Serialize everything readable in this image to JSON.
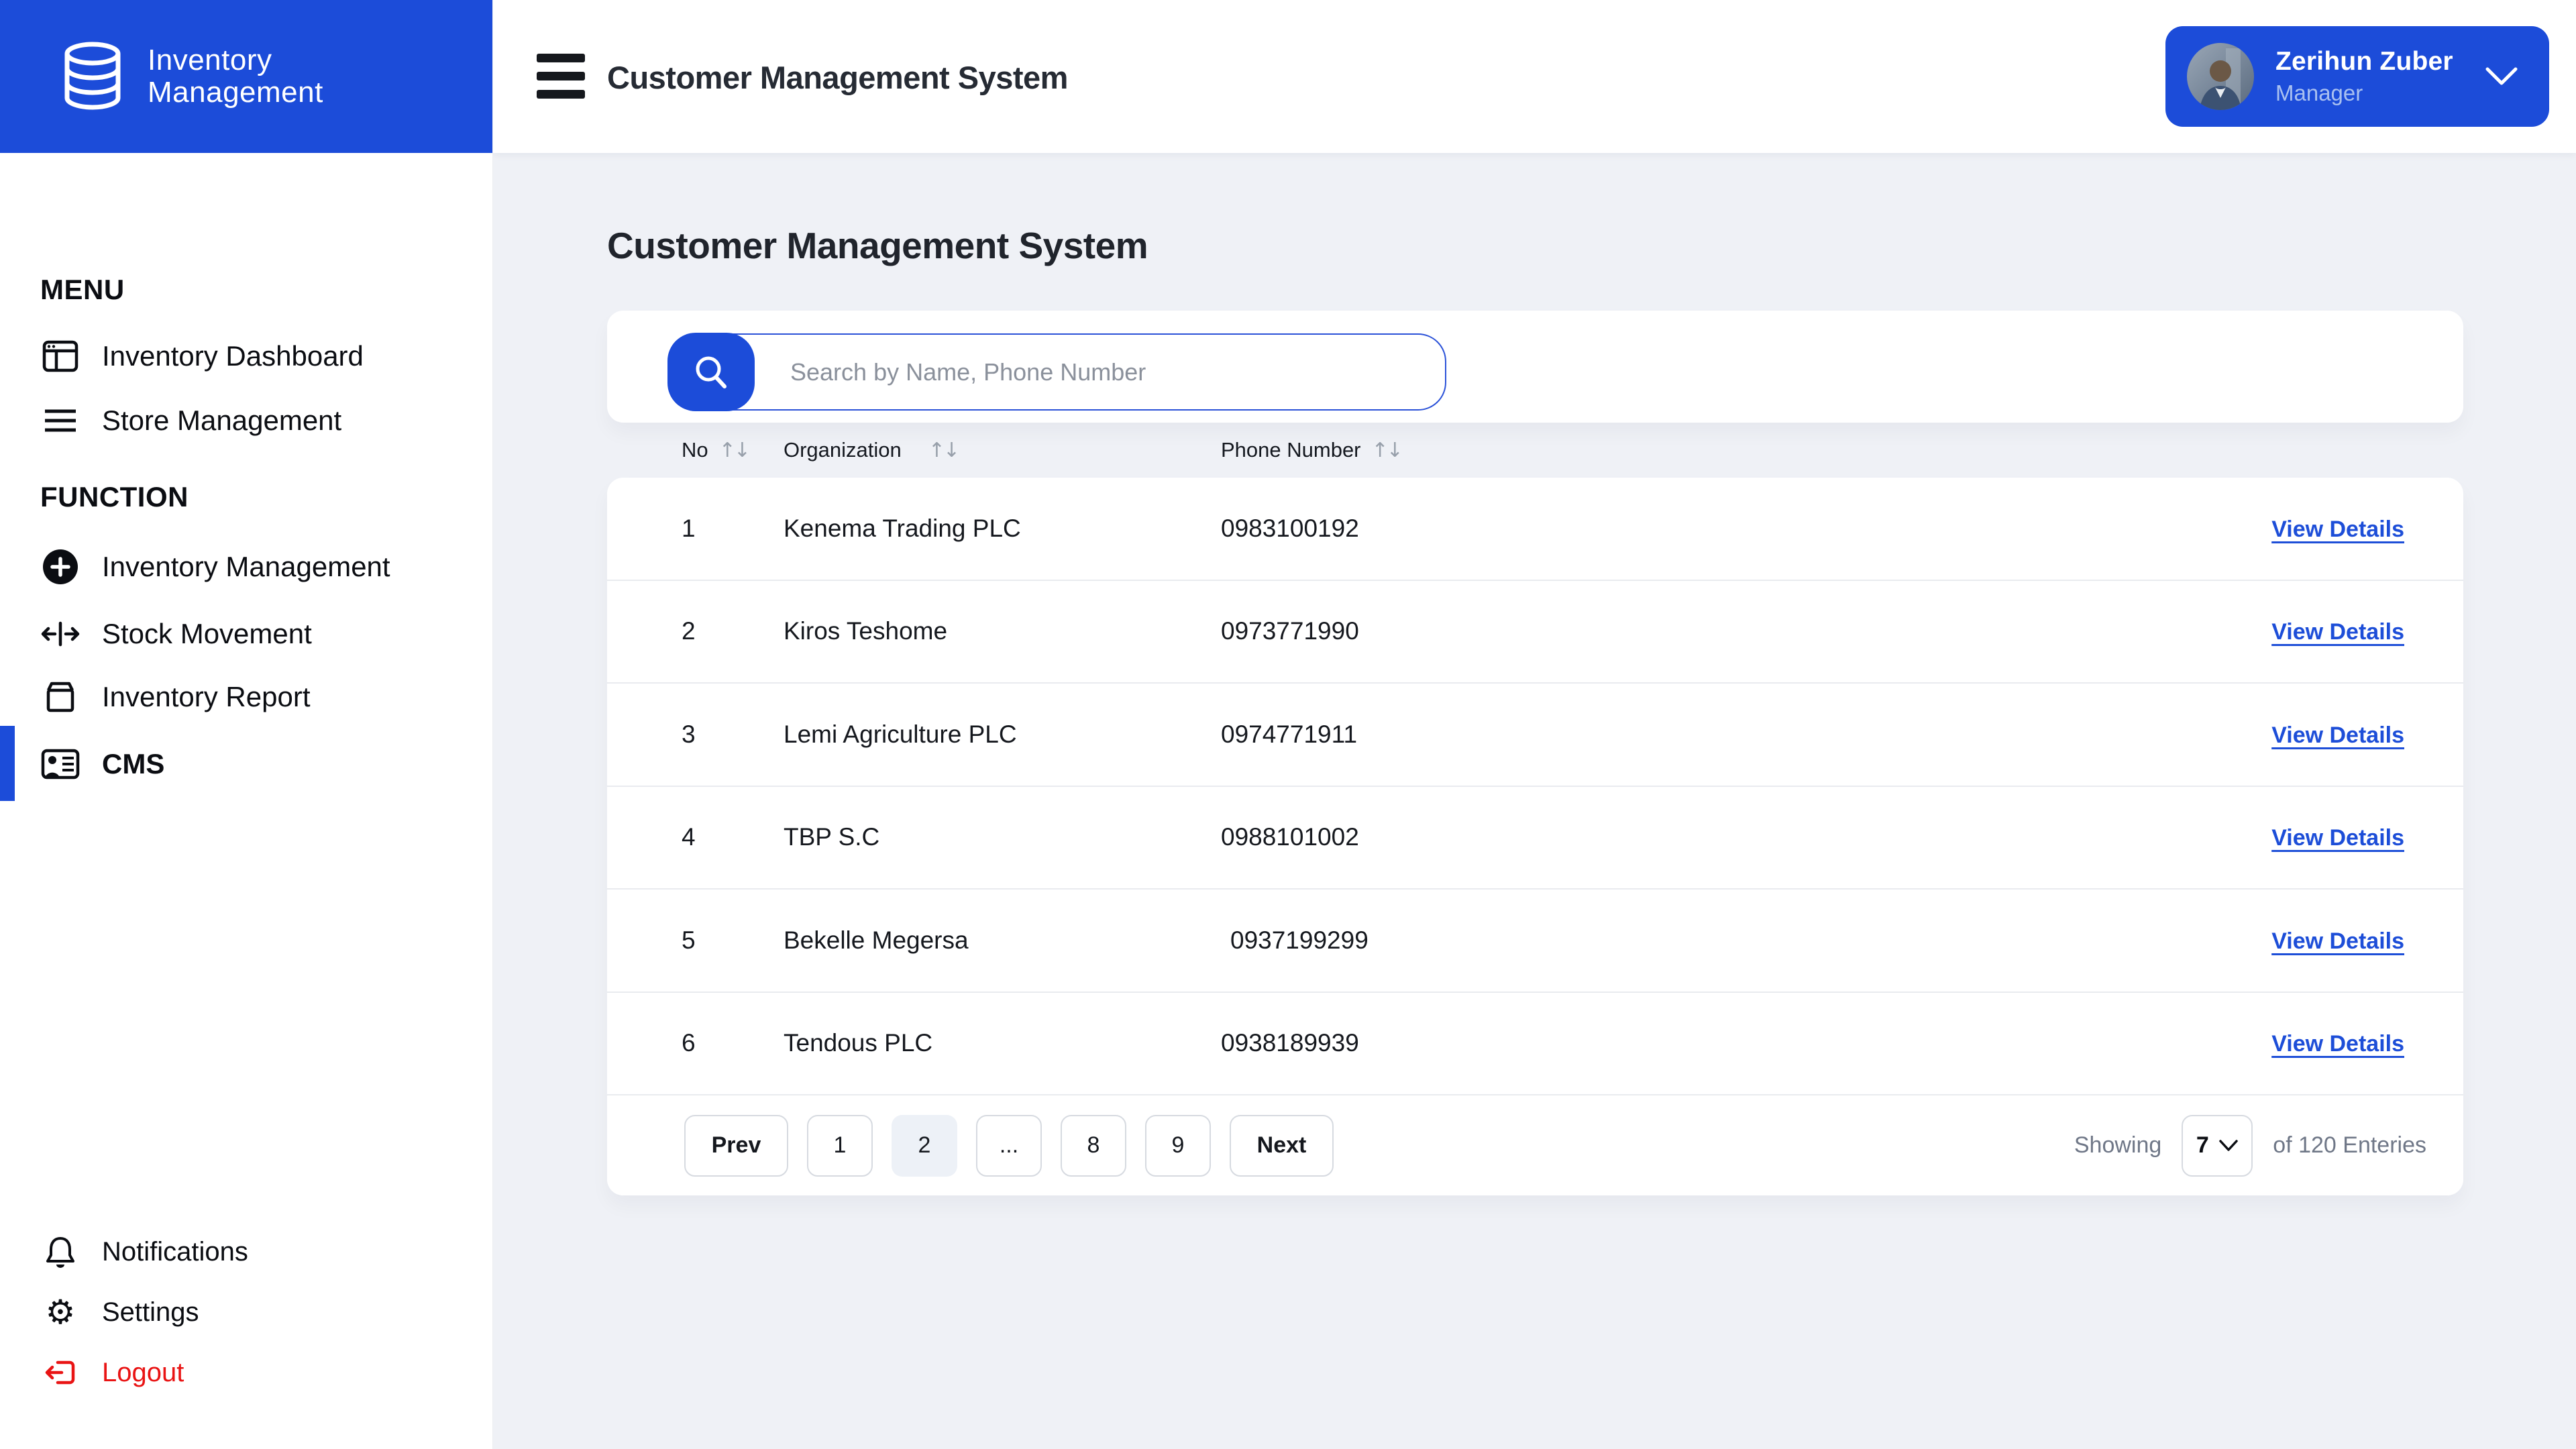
{
  "brand": {
    "line1": "Inventory",
    "line2": "Management"
  },
  "header": {
    "title": "Customer Management System",
    "user": {
      "name": "Zerihun Zuber",
      "role": "Manager"
    }
  },
  "sidebar": {
    "sections": [
      {
        "heading": "MENU",
        "items": [
          {
            "label": "Inventory Dashboard",
            "icon": "dashboard-icon"
          },
          {
            "label": "Store Management",
            "icon": "list-icon"
          }
        ]
      },
      {
        "heading": "FUNCTION",
        "items": [
          {
            "label": "Inventory Management",
            "icon": "plus-circle-icon"
          },
          {
            "label": "Stock Movement",
            "icon": "stock-movement-icon"
          },
          {
            "label": "Inventory Report",
            "icon": "package-icon"
          },
          {
            "label": "CMS",
            "icon": "id-card-icon",
            "active": true
          }
        ]
      }
    ],
    "footer": [
      {
        "label": "Notifications",
        "icon": "bell-icon"
      },
      {
        "label": "Settings",
        "icon": "gear-icon"
      },
      {
        "label": "Logout",
        "icon": "logout-icon",
        "danger": true
      }
    ]
  },
  "main": {
    "title": "Customer Management System",
    "search": {
      "placeholder": "Search by Name, Phone Number"
    },
    "table": {
      "columns": [
        "No",
        "Organization",
        "Phone Number"
      ],
      "rows": [
        {
          "no": "1",
          "organization": "Kenema Trading PLC",
          "phone": "0983100192",
          "action": "View Details"
        },
        {
          "no": "2",
          "organization": "Kiros Teshome",
          "phone": "0973771990",
          "action": "View Details"
        },
        {
          "no": "3",
          "organization": "Lemi Agriculture PLC",
          "phone": "0974771911",
          "action": "View Details"
        },
        {
          "no": "4",
          "organization": "TBP S.C",
          "phone": "0988101002",
          "action": "View Details"
        },
        {
          "no": "5",
          "organization": "Bekelle Megersa",
          "phone": "0937199299",
          "action": "View Details"
        },
        {
          "no": "6",
          "organization": "Tendous  PLC",
          "phone": "0938189939",
          "action": "View Details"
        }
      ]
    },
    "pagination": {
      "prev": "Prev",
      "pages": [
        "1",
        "2",
        "...",
        "8",
        "9"
      ],
      "active_page": "2",
      "next": "Next",
      "showing": "Showing",
      "page_size": "7",
      "of": "of 120 Enteries"
    }
  },
  "colors": {
    "brand_blue": "#1C4CD9",
    "link_blue": "#1D4ED8",
    "logout_red": "#E91414",
    "page_bg": "#EFF1F6",
    "active_page_bg": "#EDF1F7"
  }
}
